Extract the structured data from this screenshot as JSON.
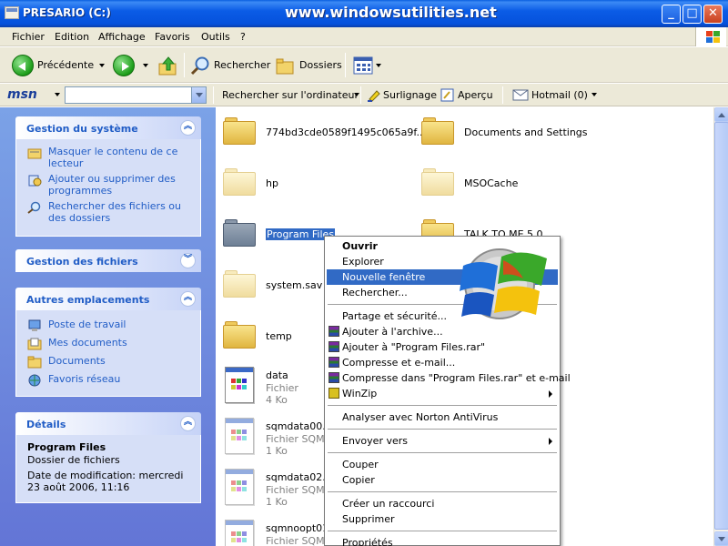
{
  "window": {
    "title": "PRESARIO (C:)",
    "watermark": "www.windowsutilities.net",
    "min_label": "_",
    "max_label": "□",
    "close_label": "✕"
  },
  "menu": [
    "Fichier",
    "Edition",
    "Affichage",
    "Favoris",
    "Outils",
    "?"
  ],
  "toolbar": {
    "back_label": "Précédente",
    "search_label": "Rechercher",
    "folders_label": "Dossiers"
  },
  "msnbar": {
    "logo": "msn",
    "search_value": "",
    "search_computer_label": "Rechercher sur l'ordinateur",
    "highlight_label": "Surlignage",
    "preview_label": "Aperçu",
    "hotmail_label": "Hotmail (0)"
  },
  "sidebar": {
    "system": {
      "title": "Gestion du système",
      "tasks": [
        "Masquer le contenu de ce lecteur",
        "Ajouter ou supprimer des programmes",
        "Rechercher des fichiers ou des dossiers"
      ]
    },
    "files": {
      "title": "Gestion des fichiers"
    },
    "places": {
      "title": "Autres emplacements",
      "items": [
        "Poste de travail",
        "Mes documents",
        "Documents",
        "Favoris réseau"
      ]
    },
    "details": {
      "title": "Détails",
      "name": "Program Files",
      "type": "Dossier de fichiers",
      "modified": "Date de modification: mercredi 23 août 2006, 11:16"
    }
  },
  "folders": [
    {
      "name": "774bd3cde0589f1495c065a9f..."
    },
    {
      "name": "Documents and Settings"
    },
    {
      "name": "hp"
    },
    {
      "name": "MSOCache"
    },
    {
      "name": "Program Files"
    },
    {
      "name": "TALK TO ME 5.0"
    },
    {
      "name": "system.sav"
    },
    {
      "name": "temp"
    }
  ],
  "files": [
    {
      "name": "data",
      "type": "Fichier",
      "size": "4 Ko"
    },
    {
      "name": "sqmdata00.sqm",
      "type": "Fichier SQM",
      "size": "1 Ko"
    },
    {
      "name": "sqmdata02.sqm",
      "type": "Fichier SQM",
      "size": "1 Ko"
    },
    {
      "name": "sqmnoopt01.sqm",
      "type": "Fichier SQM",
      "size": ""
    }
  ],
  "context_menu": [
    "Ouvrir",
    "Explorer",
    "Nouvelle fenêtre",
    "Rechercher...",
    "Partage et sécurité...",
    "Ajouter à l'archive...",
    "Ajouter à \"Program Files.rar\"",
    "Compresse et e-mail...",
    "Compresse dans \"Program Files.rar\" et e-mail",
    "WinZip",
    "Analyser avec Norton AntiVirus",
    "Envoyer vers",
    "Couper",
    "Copier",
    "Créer un raccourci",
    "Supprimer",
    "Propriétés"
  ]
}
